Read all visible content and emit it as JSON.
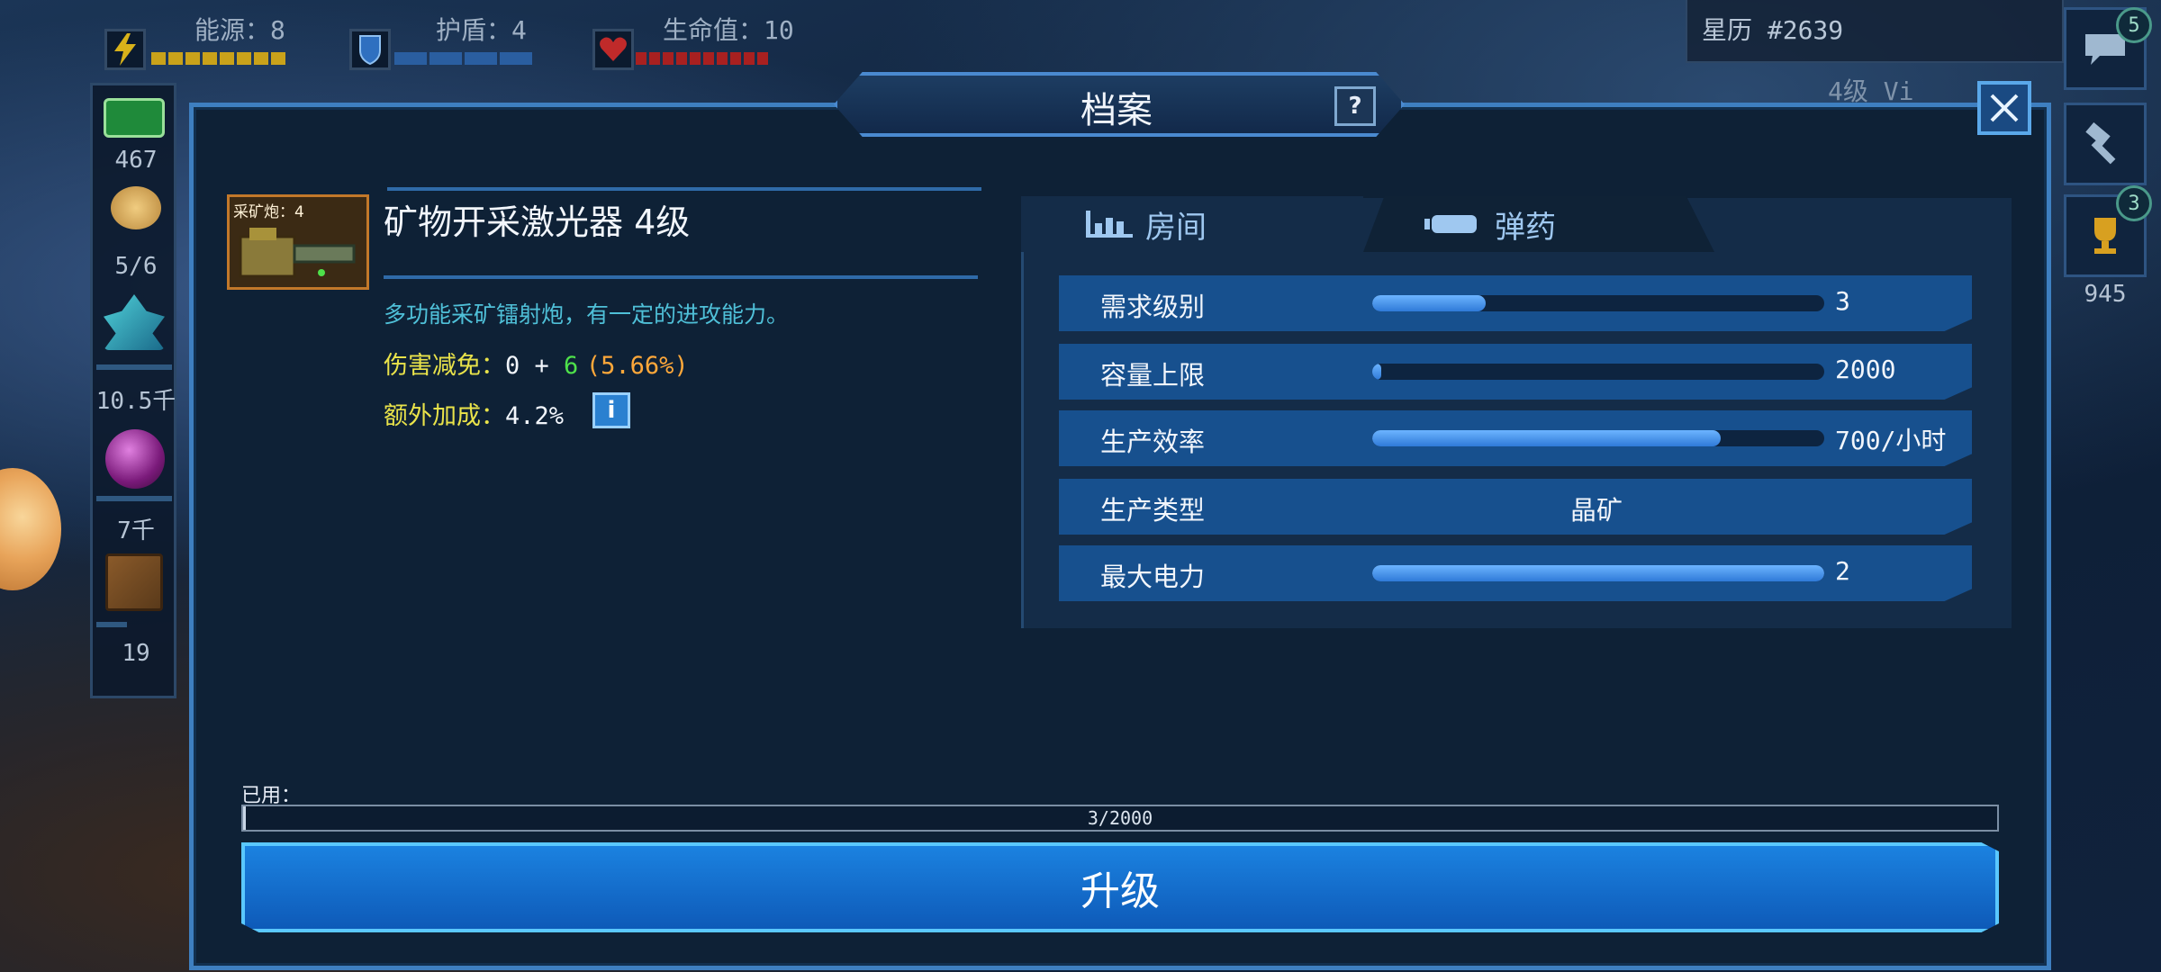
{
  "hud": {
    "energy": {
      "label": "能源：8",
      "value": 8,
      "icon": "lightning-icon",
      "color": "#d8b21a"
    },
    "shield": {
      "label": "护盾：4",
      "value": 4,
      "icon": "shield-icon",
      "color": "#2f70c0"
    },
    "life": {
      "label": "生命值：10",
      "value": 10,
      "icon": "heart-icon",
      "color": "#b82626"
    },
    "stardate": "星历 #2639",
    "level_tag": "4级 Vi"
  },
  "resources": [
    {
      "icon": "money-icon",
      "value": "467"
    },
    {
      "icon": "crew-icon",
      "value": "5/6"
    },
    {
      "icon": "crystal-icon",
      "value": "10.5千"
    },
    {
      "icon": "orb-icon",
      "value": "7千"
    },
    {
      "icon": "crate-icon",
      "value": "19"
    }
  ],
  "side_buttons": [
    {
      "icon": "chat-icon",
      "badge": "5"
    },
    {
      "icon": "hammer-icon",
      "badge": ""
    },
    {
      "icon": "trophy-icon",
      "badge": "3",
      "value": "945"
    }
  ],
  "dialog": {
    "title": "档案",
    "help": "?",
    "item": {
      "thumb_label": "采矿炮：4",
      "name": "矿物开采激光器 4级",
      "description": "多功能采矿镭射炮，有一定的进攻能力。",
      "damage_label": "伤害减免：",
      "damage_base": "0 + ",
      "damage_bonus": "6",
      "damage_percent": "(5.66%)",
      "extra_label": "额外加成：",
      "extra_value": "4.2%",
      "info": "i"
    },
    "tabs": [
      {
        "label": "房间",
        "icon": "bar-chart-icon",
        "active": true
      },
      {
        "label": "弹药",
        "icon": "battery-icon",
        "active": false
      }
    ],
    "stats": [
      {
        "label": "需求级别",
        "value": "3",
        "fill": 0.25
      },
      {
        "label": "容量上限",
        "value": "2000",
        "fill": 0.02
      },
      {
        "label": "生产效率",
        "value": "700/小时",
        "fill": 0.77
      },
      {
        "label": "生产类型",
        "value": "晶矿",
        "fill": null
      },
      {
        "label": "最大电力",
        "value": "2",
        "fill": 1.0
      }
    ],
    "used_label": "已用：",
    "used_text": "3/2000",
    "used_fraction": 0.0015,
    "upgrade_label": "升级"
  },
  "colors": {
    "accent": "#3e7fc0",
    "button": "#1b82e0",
    "desc": "#4fc0d8",
    "stat_label": "#e9e34a",
    "bonus": "#4ee04a",
    "percent": "#ffa83a"
  }
}
